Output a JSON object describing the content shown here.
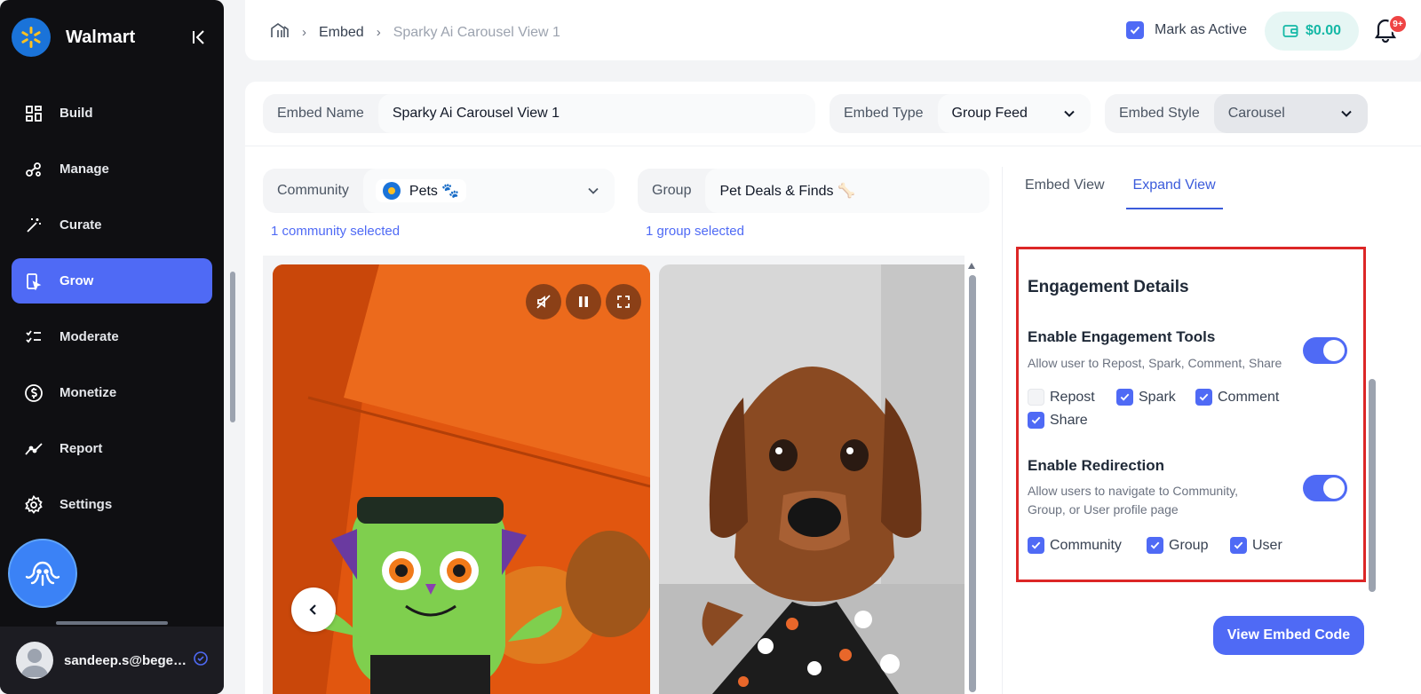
{
  "sidebar": {
    "brand_name": "Walmart",
    "nav": [
      {
        "label": "Build",
        "icon": "grid-icon"
      },
      {
        "label": "Manage",
        "icon": "nodes-icon"
      },
      {
        "label": "Curate",
        "icon": "magic-wand-icon"
      },
      {
        "label": "Grow",
        "icon": "grow-icon",
        "active": true
      },
      {
        "label": "Moderate",
        "icon": "checklist-icon"
      },
      {
        "label": "Monetize",
        "icon": "dollar-icon"
      },
      {
        "label": "Report",
        "icon": "trend-icon"
      },
      {
        "label": "Settings",
        "icon": "gear-icon"
      }
    ],
    "user_email": "sandeep.s@begen...",
    "accent": "#4f6af5"
  },
  "topbar": {
    "breadcrumb": [
      "Embed",
      "Sparky Ai Carousel View 1"
    ],
    "mark_active_label": "Mark as Active",
    "mark_active_checked": true,
    "wallet_amount": "$0.00",
    "notification_badge": "9+"
  },
  "form": {
    "embed_name_label": "Embed Name",
    "embed_name_value": "Sparky Ai Carousel View 1",
    "embed_type_label": "Embed Type",
    "embed_type_value": "Group Feed",
    "embed_style_label": "Embed Style",
    "embed_style_value": "Carousel",
    "community_label": "Community",
    "community_value": "Pets 🐾",
    "community_note": "1 community selected",
    "group_label": "Group",
    "group_value": "Pet Deals & Finds 🦴",
    "group_note": "1 group selected"
  },
  "right": {
    "tabs": [
      "Embed View",
      "Expand View"
    ],
    "active_tab": "Expand View",
    "engagement_title": "Engagement Details",
    "engagement_tools_title": "Enable Engagement Tools",
    "engagement_tools_desc": "Allow user to Repost, Spark, Comment, Share",
    "engagement_tools_on": true,
    "tools": [
      {
        "label": "Repost",
        "checked": false
      },
      {
        "label": "Spark",
        "checked": true
      },
      {
        "label": "Comment",
        "checked": true
      },
      {
        "label": "Share",
        "checked": true
      }
    ],
    "redirection_title": "Enable Redirection",
    "redirection_desc": "Allow users to navigate to Community, Group, or User profile page",
    "redirection_on": true,
    "redirect_targets": [
      {
        "label": "Community",
        "checked": true
      },
      {
        "label": "Group",
        "checked": true
      },
      {
        "label": "User",
        "checked": true
      }
    ],
    "view_embed_code_label": "View Embed Code"
  }
}
